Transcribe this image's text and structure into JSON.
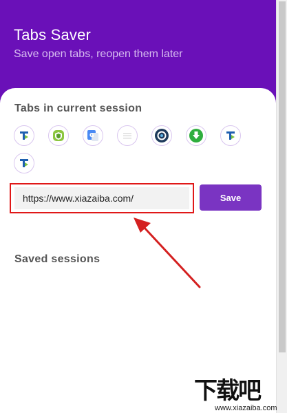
{
  "header": {
    "title": "Tabs Saver",
    "subtitle": "Save open tabs, reopen them later"
  },
  "current_session": {
    "heading": "Tabs in current session",
    "tabs": [
      {
        "icon": "xiazaiba-favicon"
      },
      {
        "icon": "android-shield-favicon"
      },
      {
        "icon": "google-translate-favicon"
      },
      {
        "icon": "blank-page-favicon"
      },
      {
        "icon": "target-ring-favicon"
      },
      {
        "icon": "green-download-favicon"
      },
      {
        "icon": "xiazaiba-favicon"
      },
      {
        "icon": "xiazaiba-favicon"
      }
    ]
  },
  "save_form": {
    "input_value": "https://www.xiazaiba.com/",
    "save_label": "Save"
  },
  "saved_sessions": {
    "heading": "Saved sessions"
  },
  "watermark": {
    "logo_text": "下载吧",
    "url": "www.xiazaiba.com"
  },
  "colors": {
    "header_bg": "#6a10b8",
    "accent": "#7a34c2",
    "highlight_border": "#e01818"
  }
}
